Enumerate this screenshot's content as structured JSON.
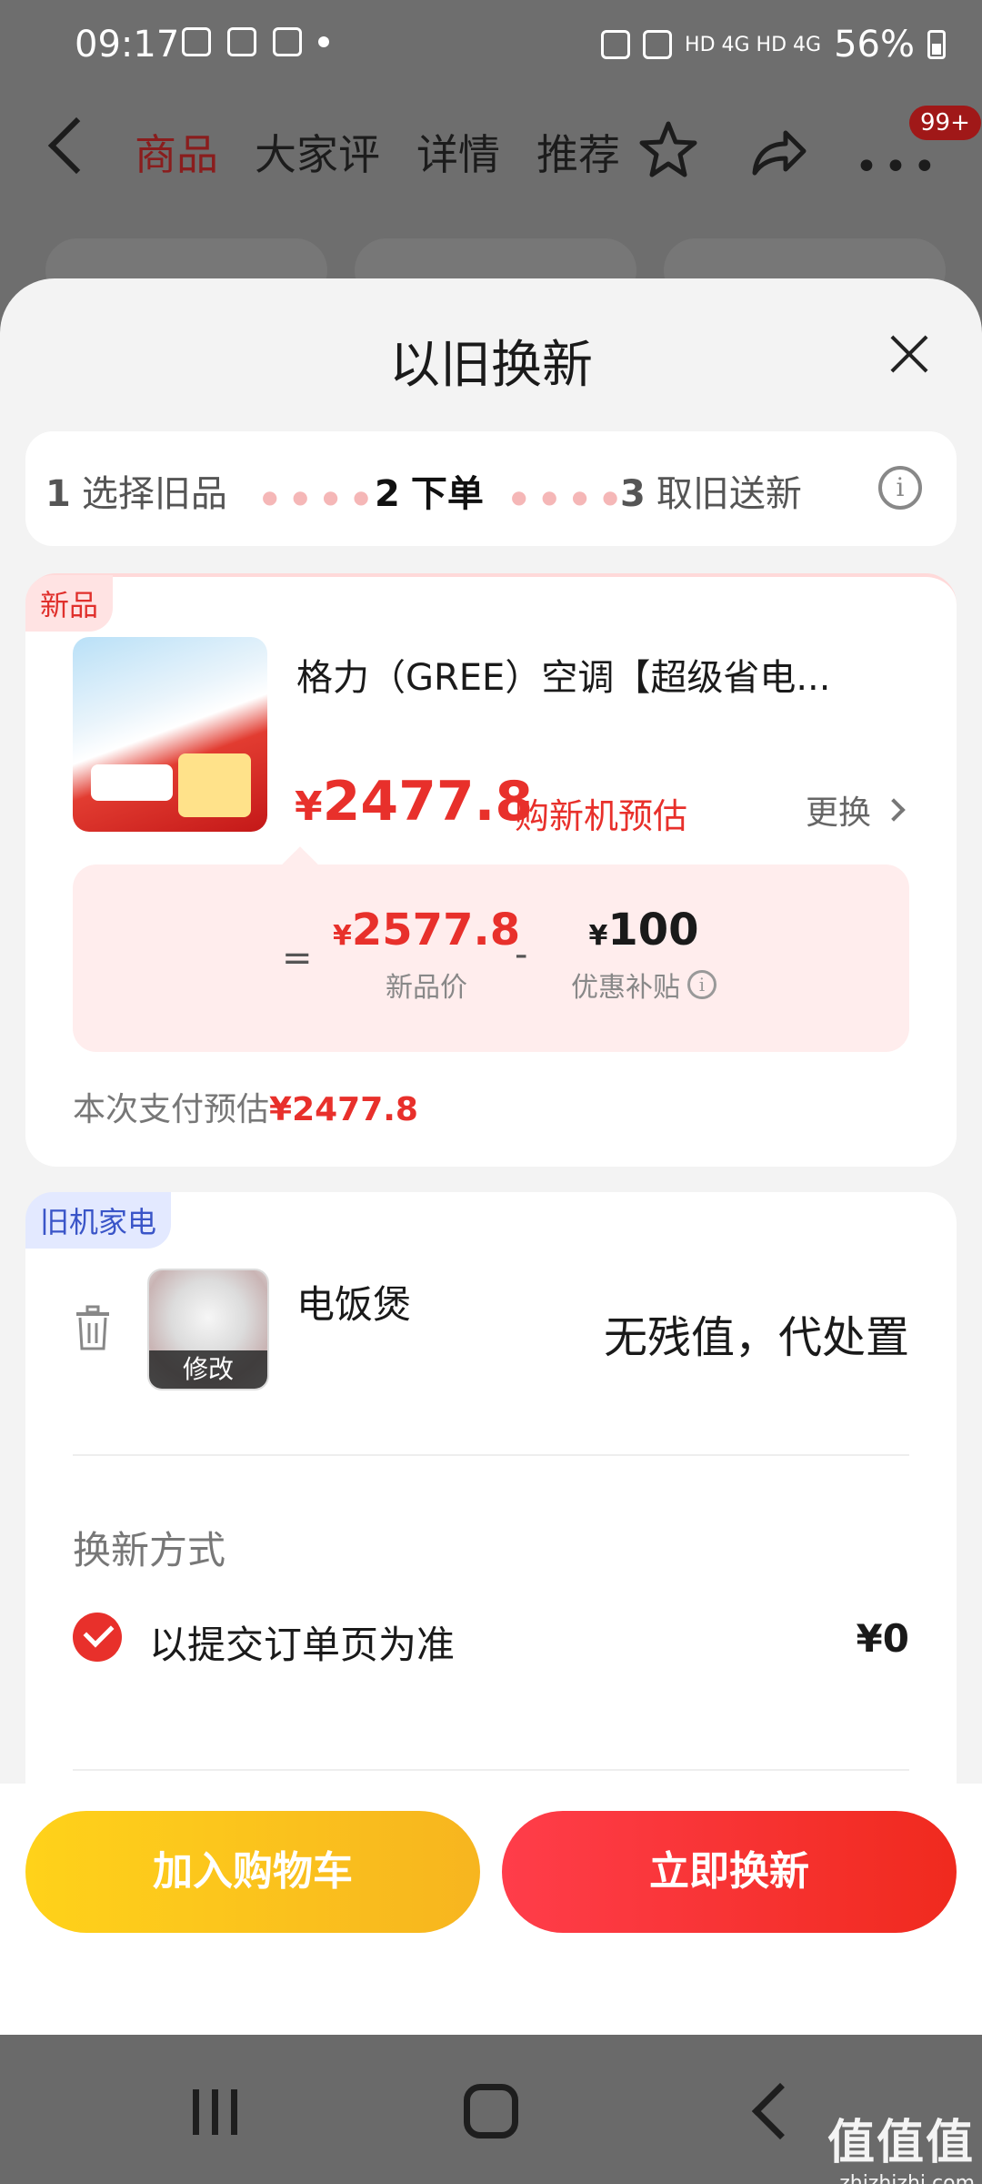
{
  "status_bar": {
    "time": "09:17",
    "battery": "56%",
    "network": "HD 4G HD 4G"
  },
  "nav": {
    "tabs": [
      "商品",
      "大家评",
      "详情",
      "推荐"
    ],
    "active_tab": "商品",
    "cart_badge": "99+"
  },
  "sheet": {
    "title": "以旧换新",
    "steps": [
      {
        "num": "1",
        "label": "选择旧品"
      },
      {
        "num": "2",
        "label": "下单"
      },
      {
        "num": "3",
        "label": "取旧送新"
      }
    ],
    "active_step": 2
  },
  "new_product": {
    "tag": "新品",
    "title": "格力（GREE）空调【超级省电...",
    "price_symbol": "¥",
    "price": "2477.8",
    "price_note": "购新机预估",
    "change_label": "更换",
    "calc": {
      "equals": "=",
      "minus": "-",
      "new_price": "2577.8",
      "new_price_label": "新品价",
      "subsidy": "100",
      "subsidy_label": "优惠补贴"
    },
    "pay_estimate_label": "本次支付预估",
    "pay_estimate_amount": "¥2477.8"
  },
  "old_appliance": {
    "tag": "旧机家电",
    "name": "电饭煲",
    "modify_label": "修改",
    "value_text": "无残值，代处置",
    "method_heading": "换新方式",
    "method_label": "以提交订单页为准",
    "method_price": "¥0"
  },
  "actions": {
    "add_to_cart": "加入购物车",
    "trade_now": "立即换新"
  },
  "watermark": {
    "main": "值值值",
    "sub": "zhizhizhi.com"
  },
  "colors": {
    "accent_red": "#e8302b",
    "cart_yellow": "#ffd21a",
    "old_tag_blue": "#3a55c8"
  }
}
